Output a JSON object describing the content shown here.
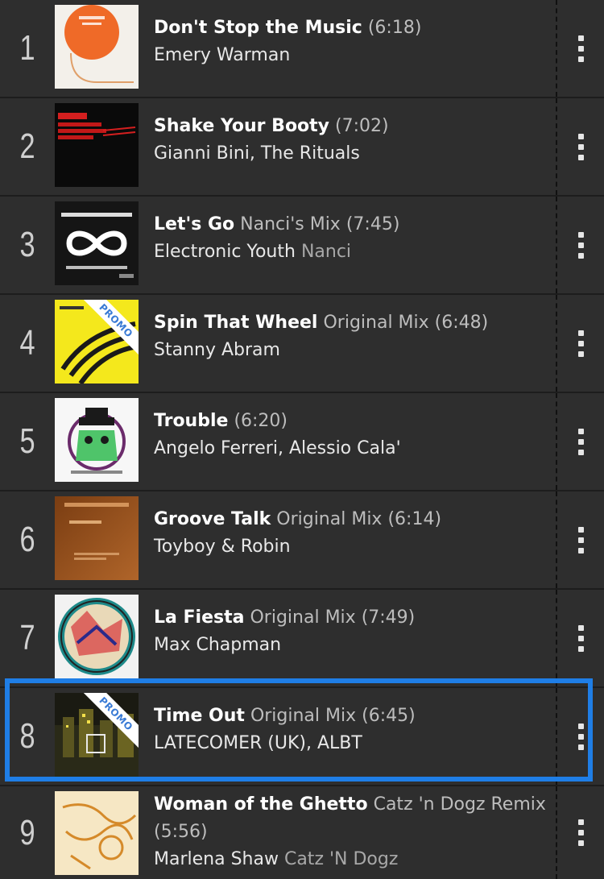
{
  "tracks": [
    {
      "rank": "1",
      "title": "Don't Stop the Music",
      "mix": "",
      "duration": "(6:18)",
      "artists": "Emery Warman",
      "remixer": "",
      "promo": false,
      "art": "orange"
    },
    {
      "rank": "2",
      "title": "Shake Your Booty",
      "mix": "",
      "duration": "(7:02)",
      "artists": "Gianni Bini, The Rituals",
      "remixer": "",
      "promo": false,
      "art": "black-red"
    },
    {
      "rank": "3",
      "title": "Let's Go",
      "mix": "Nanci's Mix",
      "duration": "(7:45)",
      "artists": "Electronic Youth",
      "remixer": "Nanci",
      "promo": false,
      "art": "infinity"
    },
    {
      "rank": "4",
      "title": "Spin That Wheel",
      "mix": "Original Mix",
      "duration": "(6:48)",
      "artists": "Stanny Abram",
      "remixer": "",
      "promo": true,
      "promo_label": "PROMO",
      "art": "yellow"
    },
    {
      "rank": "5",
      "title": "Trouble",
      "mix": "",
      "duration": "(6:20)",
      "artists": "Angelo Ferreri, Alessio Cala'",
      "remixer": "",
      "promo": false,
      "art": "face"
    },
    {
      "rank": "6",
      "title": "Groove Talk",
      "mix": "Original Mix",
      "duration": "(6:14)",
      "artists": "Toyboy & Robin",
      "remixer": "",
      "promo": false,
      "art": "brown"
    },
    {
      "rank": "7",
      "title": "La Fiesta",
      "mix": "Original Mix",
      "duration": "(7:49)",
      "artists": "Max Chapman",
      "remixer": "",
      "promo": false,
      "art": "circle"
    },
    {
      "rank": "8",
      "title": "Time Out",
      "mix": "Original Mix",
      "duration": "(6:45)",
      "artists": "LATECOMER (UK), ALBT",
      "remixer": "",
      "promo": true,
      "promo_label": "PROMO",
      "art": "city",
      "highlighted": true
    },
    {
      "rank": "9",
      "title": "Woman of the Ghetto",
      "mix": "Catz 'n Dogz Remix",
      "duration": "(5:56)",
      "artists": "Marlena Shaw",
      "remixer": "Catz 'N Dogz",
      "promo": false,
      "art": "sketch"
    }
  ],
  "colors": {
    "background": "#2e2e2e",
    "highlight_border": "#1f7ee6",
    "promo_text": "#3a7bd5"
  },
  "icons": {
    "menu": "more-vertical-icon"
  }
}
